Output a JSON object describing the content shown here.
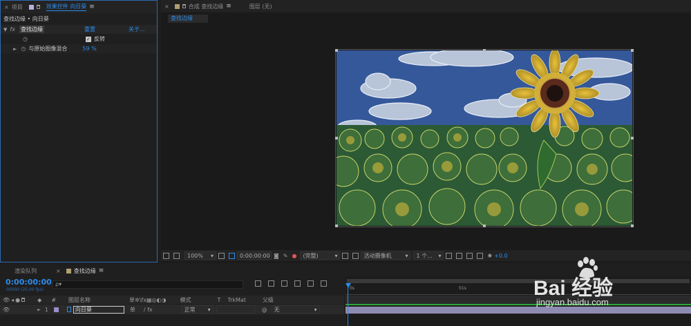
{
  "left_panel": {
    "tabs": [
      {
        "label": "项目"
      },
      {
        "label": "效果控件 向日葵"
      }
    ],
    "header": "查找边缘 • 向日葵",
    "effect": {
      "fx_label": "fx",
      "name": "查找边缘",
      "reset": "重置",
      "about": "关于..."
    },
    "invert": {
      "label": "反转",
      "checked": true
    },
    "blend": {
      "label": "与原始图像混合",
      "value": "59 %"
    }
  },
  "comp_panel": {
    "tabs": [
      {
        "label": "合成 查找边缘"
      },
      {
        "label": "图层 (无)"
      }
    ],
    "subtab": "查找边缘"
  },
  "viewer_toolbar": {
    "zoom": "100%",
    "timecode": "0:00:00:00",
    "resolution": "(完整)",
    "camera": "活动摄像机",
    "views": "1 个...",
    "exposure": "+0.0"
  },
  "timeline": {
    "tabs": [
      {
        "label": "渲染队列"
      },
      {
        "label": "查找边缘"
      }
    ],
    "timecode": "0:00:00:00",
    "fps": "00000 (25.00 fps)",
    "search_placeholder": "ρ▾",
    "ruler": {
      "start": "0s",
      "mark": "01s"
    },
    "columns": {
      "num": "#",
      "name": "图层名称",
      "mode": "模式",
      "t": "T",
      "trkmat": "TrkMat",
      "parent": "父级"
    },
    "layer": {
      "num": "1",
      "name": "向日葵",
      "mode": "正常",
      "parent": "无"
    }
  },
  "watermark": {
    "brand": "Bai 经验",
    "url": "jingyan.baidu.com"
  },
  "colors": {
    "accent": "#2d8ceb",
    "layer_bar": "#8f8cb3",
    "tab_sq": "#9b8dc8"
  }
}
